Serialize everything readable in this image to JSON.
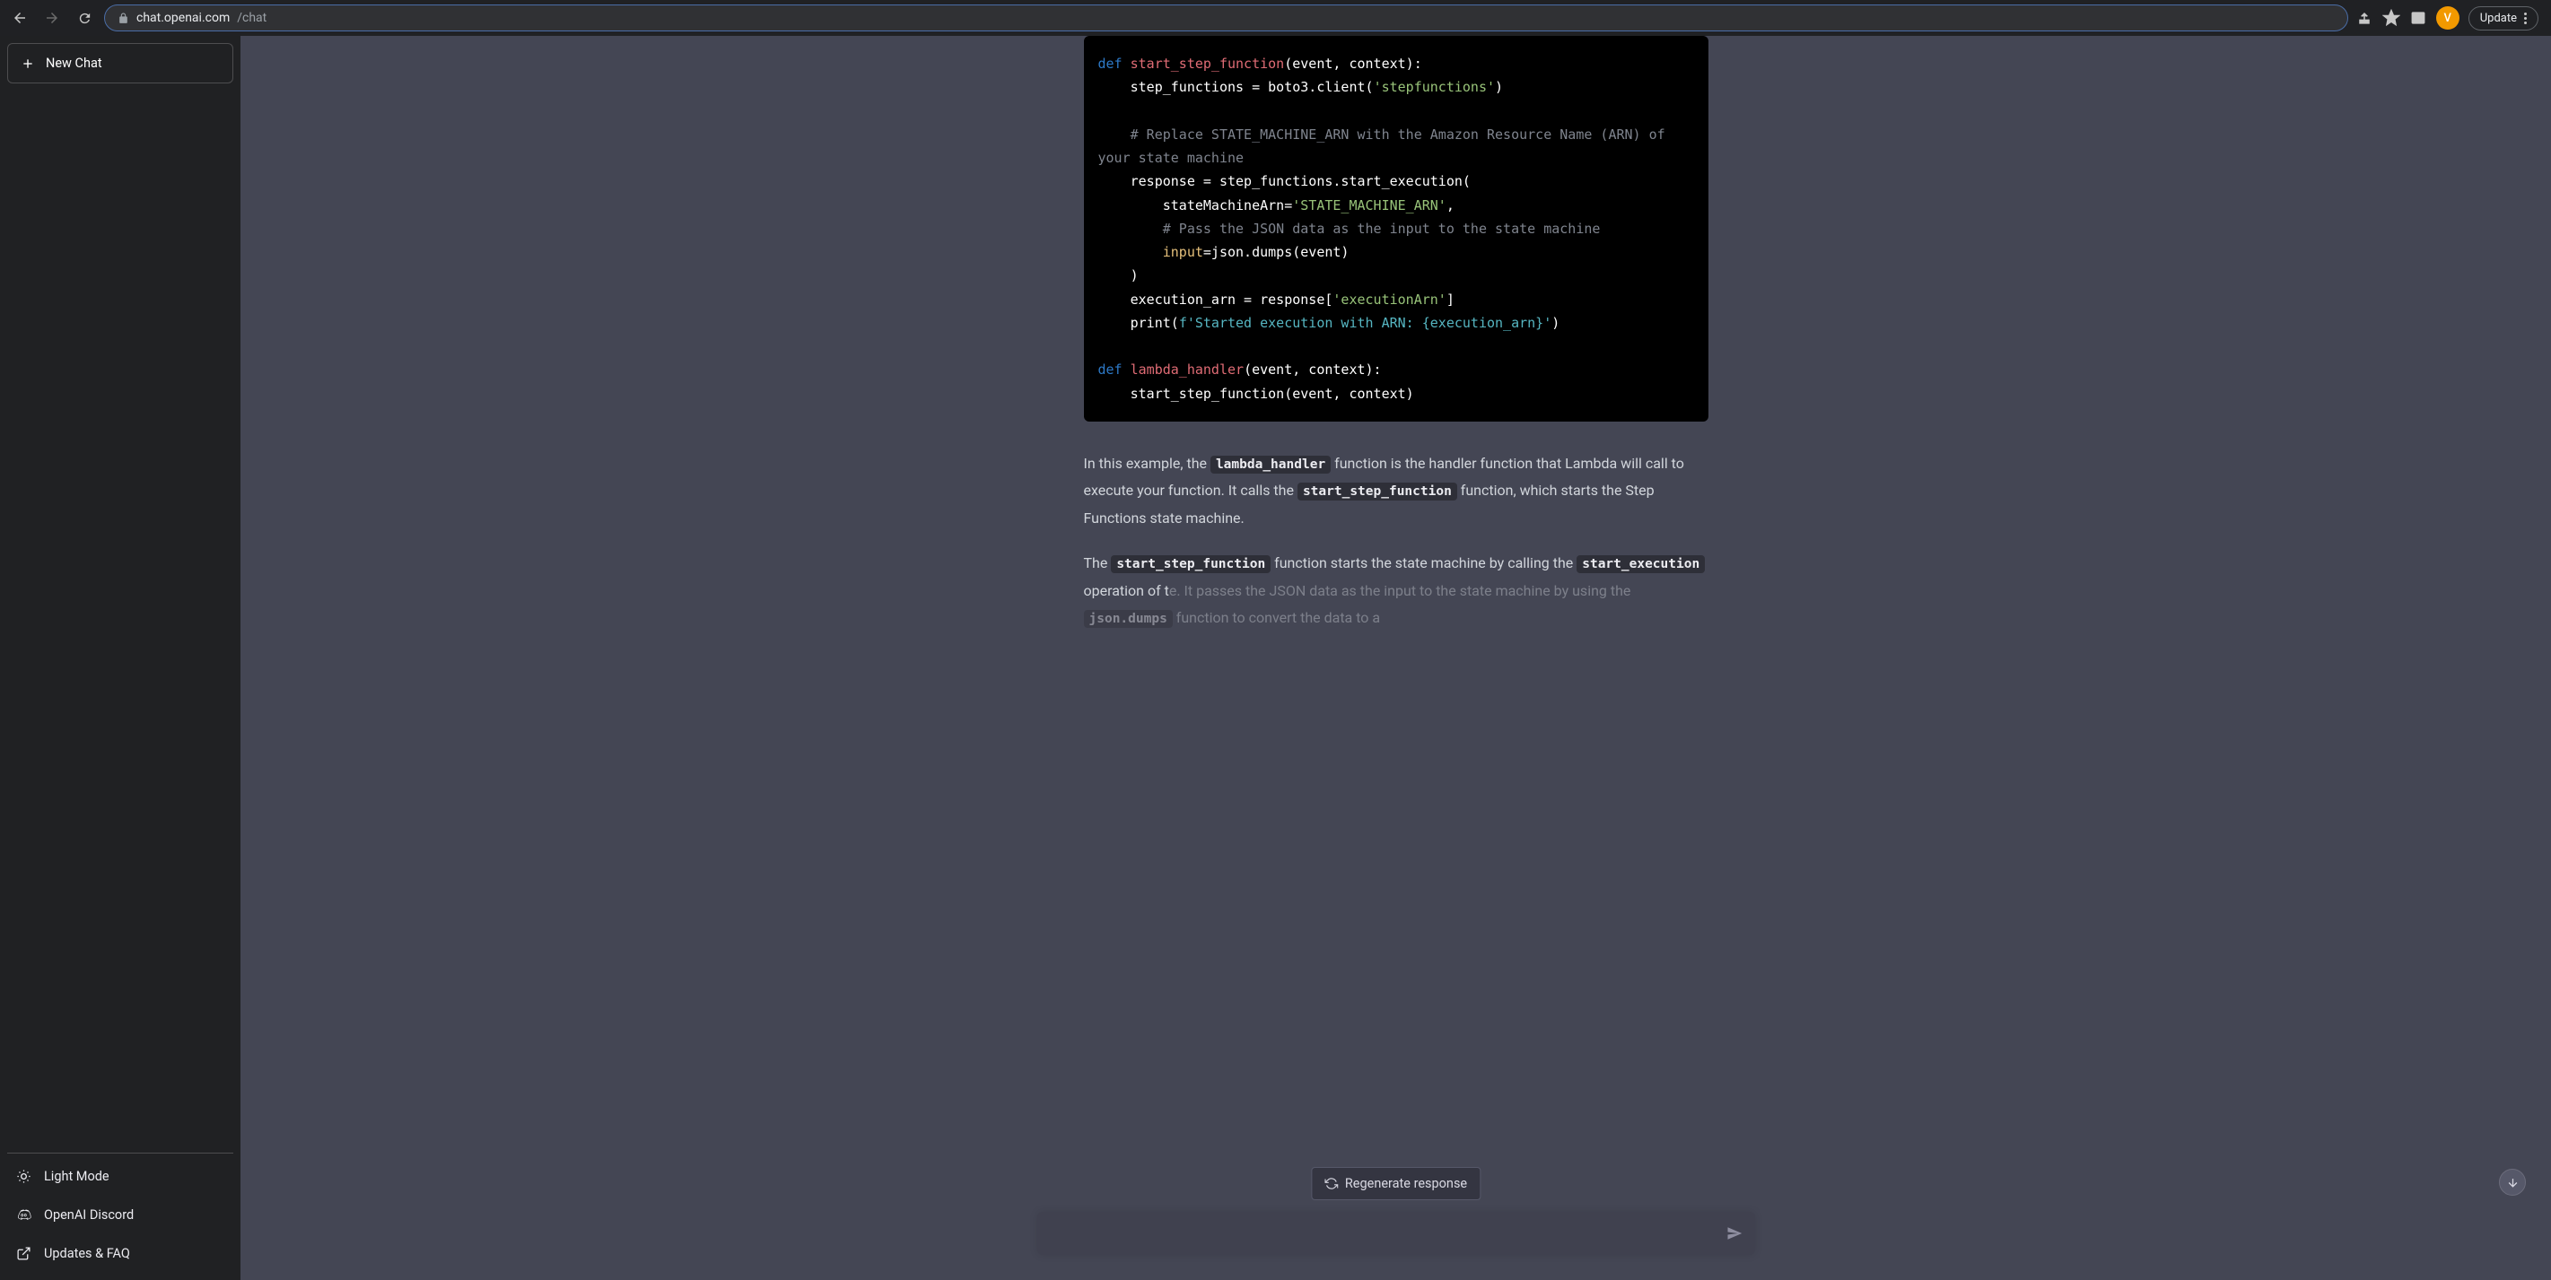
{
  "browser": {
    "url_domain": "chat.openai.com",
    "url_path": "/chat",
    "avatar_letter": "V",
    "update_label": "Update"
  },
  "sidebar": {
    "new_chat": "New Chat",
    "items": {
      "light_mode": "Light Mode",
      "discord": "OpenAI Discord",
      "updates_faq": "Updates & FAQ"
    }
  },
  "code": {
    "l1_def": "def ",
    "l1_fn": "start_step_function",
    "l1_rest": "(event, context):",
    "l2a": "    step_functions = boto3.client(",
    "l2b": "'stepfunctions'",
    "l2c": ")",
    "l3": "    # Replace STATE_MACHINE_ARN with the Amazon Resource Name (ARN) of your state machine",
    "l4": "    response = step_functions.start_execution(",
    "l5a": "        stateMachineArn=",
    "l5b": "'STATE_MACHINE_ARN'",
    "l5c": ",",
    "l6": "        # Pass the JSON data as the input to the state machine",
    "l7a": "        ",
    "l7arg": "input",
    "l7b": "=json.dumps(event)",
    "l8": "    )",
    "l9a": "    execution_arn = response[",
    "l9b": "'executionArn'",
    "l9c": "]",
    "l10a": "    print(",
    "l10b": "f'Started execution with ARN: {execution_arn}'",
    "l10c": ")",
    "l11_def": "def ",
    "l11_fn": "lambda_handler",
    "l11_rest": "(event, context):",
    "l12": "    start_step_function(event, context)"
  },
  "prose": {
    "p1a": "In this example, the ",
    "p1_code1": "lambda_handler",
    "p1b": " function is the handler function that Lambda will call to execute your function. It calls the ",
    "p1_code2": "start_step_function",
    "p1c": " function, which starts the Step Functions state machine.",
    "p2a": "The ",
    "p2_code1": "start_step_function",
    "p2b": " function starts the state machine by calling the ",
    "p2_code2": "start_execution",
    "p2c": " operation of t",
    "p2d": "e. It passes the JSON data as the input to the state machine by using the ",
    "p2_code3": "json.dumps",
    "p2e": " function to convert the data to a"
  },
  "actions": {
    "regenerate": "Regenerate response"
  }
}
